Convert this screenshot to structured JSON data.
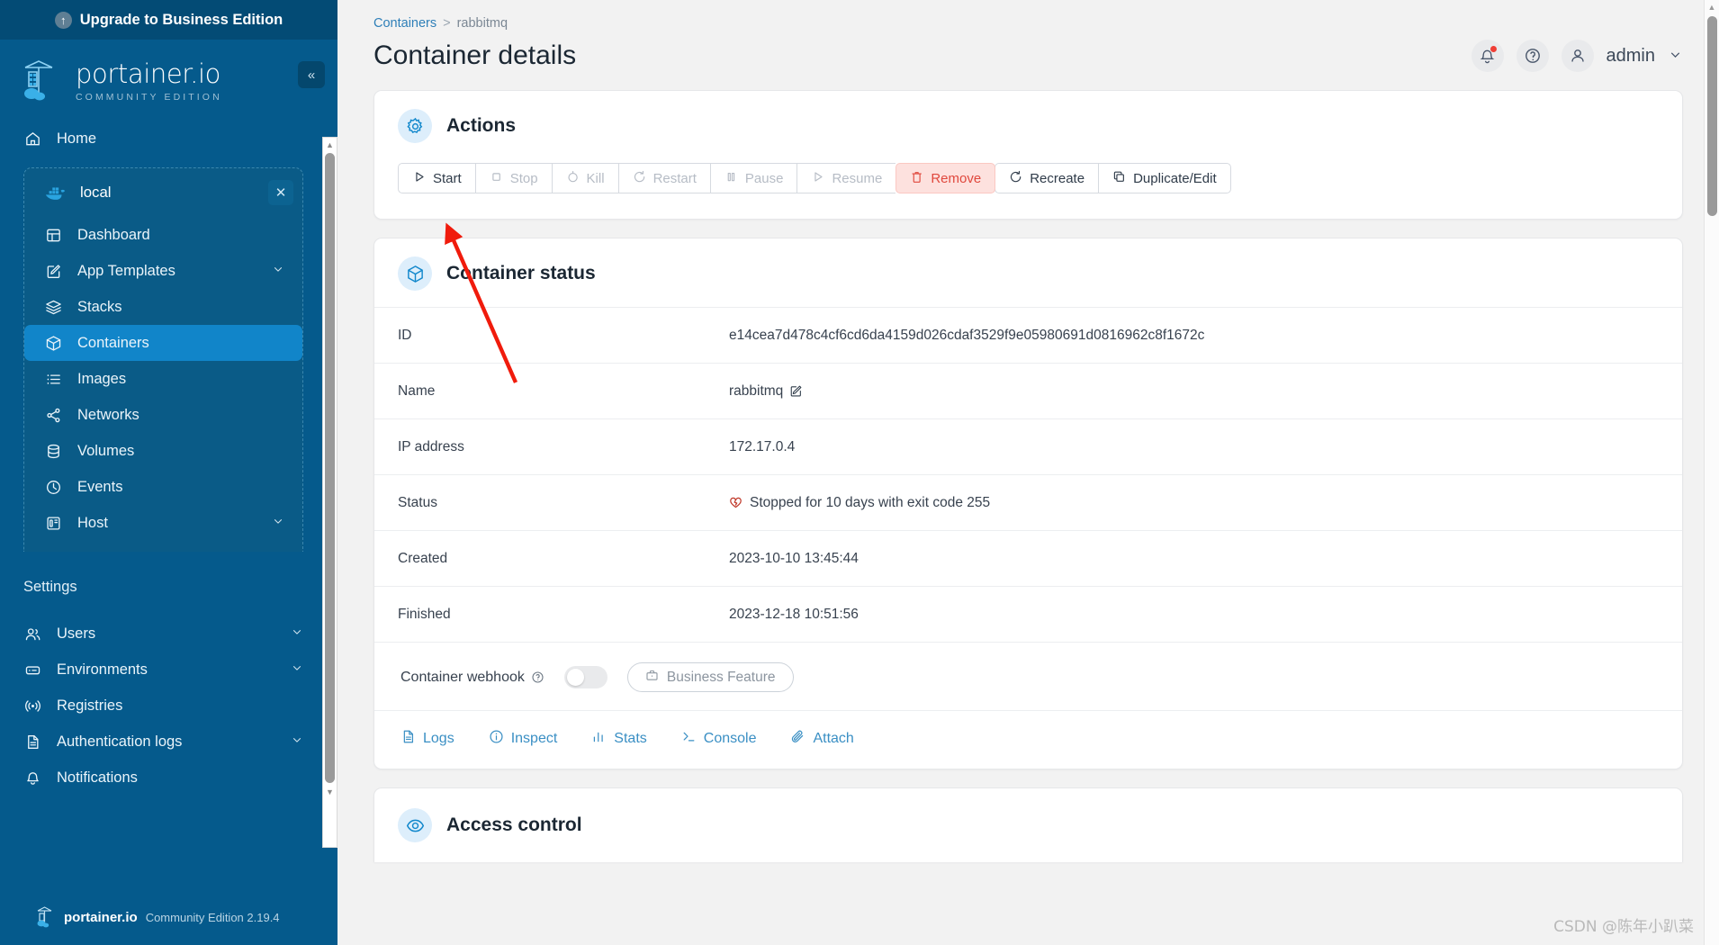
{
  "sidebar": {
    "upgrade_banner": "Upgrade to Business Edition",
    "brand": "portainer.io",
    "edition": "COMMUNITY EDITION",
    "home_label": "Home",
    "environment": {
      "name": "local",
      "icon": "docker-icon"
    },
    "env_items": [
      {
        "label": "Dashboard",
        "icon": "dashboard-icon",
        "expandable": false,
        "active": false
      },
      {
        "label": "App Templates",
        "icon": "edit-square-icon",
        "expandable": true,
        "active": false
      },
      {
        "label": "Stacks",
        "icon": "layers-icon",
        "expandable": false,
        "active": false
      },
      {
        "label": "Containers",
        "icon": "box-icon",
        "expandable": false,
        "active": true
      },
      {
        "label": "Images",
        "icon": "list-icon",
        "expandable": false,
        "active": false
      },
      {
        "label": "Networks",
        "icon": "share-icon",
        "expandable": false,
        "active": false
      },
      {
        "label": "Volumes",
        "icon": "database-icon",
        "expandable": false,
        "active": false
      },
      {
        "label": "Events",
        "icon": "clock-icon",
        "expandable": false,
        "active": false
      },
      {
        "label": "Host",
        "icon": "server-panel-icon",
        "expandable": true,
        "active": false
      }
    ],
    "settings_title": "Settings",
    "settings_items": [
      {
        "label": "Users",
        "icon": "users-icon",
        "expandable": true
      },
      {
        "label": "Environments",
        "icon": "environment-icon",
        "expandable": true
      },
      {
        "label": "Registries",
        "icon": "registry-icon",
        "expandable": false
      },
      {
        "label": "Authentication logs",
        "icon": "document-icon",
        "expandable": true
      },
      {
        "label": "Notifications",
        "icon": "bell-icon",
        "expandable": false
      }
    ],
    "footer_brand": "portainer.io",
    "footer_version": "Community Edition 2.19.4"
  },
  "header": {
    "breadcrumb": {
      "parent": "Containers",
      "separator": ">",
      "current": "rabbitmq"
    },
    "title": "Container details",
    "user": "admin",
    "notification_icon": "bell-icon",
    "help_icon": "question-circle-icon",
    "avatar_icon": "user-icon",
    "caret_icon": "chevron-down-icon"
  },
  "actions": {
    "title": "Actions",
    "icon": "gear-icon",
    "buttons": [
      {
        "label": "Start",
        "icon": "play-icon",
        "state": "enabled"
      },
      {
        "label": "Stop",
        "icon": "square-icon",
        "state": "disabled"
      },
      {
        "label": "Kill",
        "icon": "slash-circle-icon",
        "state": "disabled"
      },
      {
        "label": "Restart",
        "icon": "refresh-icon",
        "state": "disabled"
      },
      {
        "label": "Pause",
        "icon": "pause-icon",
        "state": "disabled"
      },
      {
        "label": "Resume",
        "icon": "play-icon",
        "state": "disabled"
      },
      {
        "label": "Remove",
        "icon": "trash-icon",
        "state": "danger"
      },
      {
        "label": "Recreate",
        "icon": "refresh-icon",
        "state": "enabled"
      },
      {
        "label": "Duplicate/Edit",
        "icon": "copy-icon",
        "state": "enabled"
      }
    ],
    "danger_color": "#e0483d",
    "danger_bg": "#fde1de"
  },
  "container_status": {
    "title": "Container status",
    "icon": "box-icon",
    "rows": [
      {
        "key": "ID",
        "value": "e14cea7d478c4cf6cd6da4159d026cdaf3529f9e05980691d0816962c8f1672c"
      },
      {
        "key": "Name",
        "value": "rabbitmq",
        "edit_icon": "pencil-square-icon"
      },
      {
        "key": "IP address",
        "value": "172.17.0.4"
      },
      {
        "key": "Status",
        "value": "Stopped for 10 days with exit code 255",
        "status_icon": "heart-broken-icon",
        "status_color": "#c0392b"
      },
      {
        "key": "Created",
        "value": "2023-10-10 13:45:44"
      },
      {
        "key": "Finished",
        "value": "2023-12-18 10:51:56"
      }
    ],
    "webhook": {
      "label": "Container webhook",
      "help_icon": "question-circle-icon",
      "toggle_on": false,
      "business_pill": "Business Feature",
      "business_icon": "briefcase-icon"
    },
    "links": [
      {
        "label": "Logs",
        "icon": "document-icon"
      },
      {
        "label": "Inspect",
        "icon": "info-circle-icon"
      },
      {
        "label": "Stats",
        "icon": "bar-chart-icon"
      },
      {
        "label": "Console",
        "icon": "terminal-icon"
      },
      {
        "label": "Attach",
        "icon": "paperclip-icon"
      }
    ]
  },
  "access_control": {
    "title": "Access control",
    "icon": "eye-icon"
  },
  "watermark": "CSDN @陈年小趴菜",
  "colors": {
    "sidebar_bg": "#055a8c",
    "sidebar_banner": "#034b75",
    "active_item": "#1185c9",
    "accent": "#1288cc",
    "link": "#3a8fc4",
    "page_bg": "#f2f2f2"
  }
}
